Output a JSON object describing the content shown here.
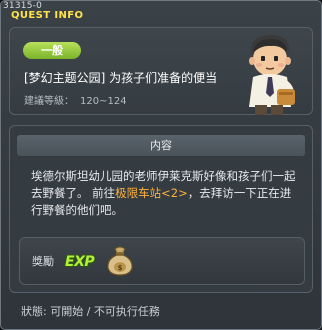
{
  "window": {
    "quest_id": "31315-0",
    "title": "QUEST INFO"
  },
  "header": {
    "category": "一般",
    "quest_name": "[梦幻主题公园] 为孩子们准备的便当",
    "level_label": "建議等級：",
    "level_range": "120~124",
    "npc_icon": "npc-boy-portrait"
  },
  "content": {
    "tab_label": "内容",
    "desc_part1": "埃德尔斯坦幼儿园的老师伊莱克斯好像和孩子们一起去野餐了。 前往",
    "desc_link": "极限车站<2>",
    "desc_part2": "，去拜访一下正在进行野餐的他们吧。",
    "link_color": "#ffb13b"
  },
  "reward": {
    "label": "獎勵",
    "exp_text": "EXP",
    "bag_icon": "money-bag-icon"
  },
  "status": {
    "text": "狀態: 可開始 / 不可执行任務"
  }
}
